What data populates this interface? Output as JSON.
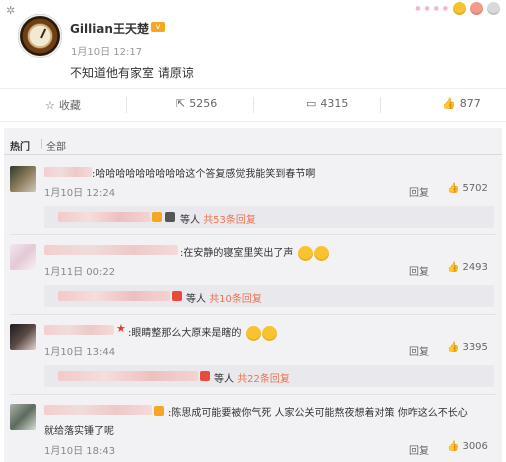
{
  "post": {
    "username": "Gillian王天楚",
    "time": "1月10日 12:17",
    "text": "不知道他有家室 请原谅"
  },
  "actions": {
    "collect_label": "收藏",
    "share_count": "5256",
    "comment_count": "4315",
    "like_count": "877"
  },
  "comments_tabs": {
    "hot": "热门",
    "all": "全部"
  },
  "comments": [
    {
      "text": ":哈哈哈哈哈哈哈哈哈这个答复感觉我能笑到春节啊",
      "time": "1月10日 12:24",
      "reply": "回复",
      "likes": "5702",
      "sub": {
        "prefix": "等人",
        "link": "共53条回复"
      }
    },
    {
      "text": ":在安静的寝室里笑出了声",
      "time": "1月11日 00:22",
      "reply": "回复",
      "likes": "2493",
      "sub": {
        "prefix": "等人",
        "link": "共10条回复"
      }
    },
    {
      "text": ":眼睛整那么大原来是瞎的",
      "time": "1月10日 13:44",
      "reply": "回复",
      "likes": "3395",
      "sub": {
        "prefix": "等人",
        "link": "共22条回复"
      }
    },
    {
      "text": ":陈思成可能要被你气死 人家公关可能熬夜想着对策 你咋这么不长心",
      "text2": "就给落实锤了呢",
      "time": "1月10日 18:43",
      "reply": "回复",
      "likes": "3006"
    }
  ]
}
